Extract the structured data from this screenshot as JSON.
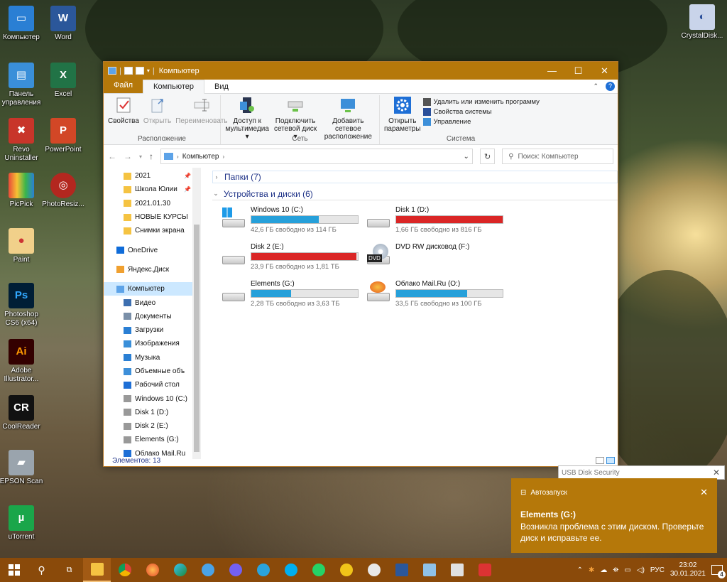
{
  "desktop": {
    "icons": [
      {
        "label": "Компьютер"
      },
      {
        "label": "Word"
      },
      {
        "label": "Панель управления"
      },
      {
        "label": "Excel"
      },
      {
        "label": "Revo Uninstaller"
      },
      {
        "label": "PowerPoint"
      },
      {
        "label": "PicPick"
      },
      {
        "label": "PhotoResiz..."
      },
      {
        "label": "Paint"
      },
      {
        "label": "Photoshop CS6 (x64)"
      },
      {
        "label": "Adobe Illustrator..."
      },
      {
        "label": "CoolReader"
      },
      {
        "label": "EPSON Scan"
      },
      {
        "label": "uTorrent"
      },
      {
        "label": "CrystalDisk..."
      }
    ],
    "glyphs": {
      "word": "W",
      "excel": "X",
      "powerpoint": "P",
      "photoshop": "Ps",
      "illustrator": "Ai",
      "coolreader": "CR",
      "utorrent": "µ"
    }
  },
  "window": {
    "title": "Компьютер",
    "controls": {
      "minimize": "—",
      "maximize": "☐",
      "close": "✕"
    },
    "tabs": {
      "file": "Файл",
      "computer": "Компьютер",
      "view": "Вид"
    },
    "ribbon": {
      "location": {
        "name": "Расположение",
        "properties": "Свойства",
        "open": "Открыть",
        "rename": "Переименовать"
      },
      "network": {
        "name": "Сеть",
        "media_1": "Доступ к",
        "media_2": "мультимедиа",
        "map_1": "Подключить",
        "map_2": "сетевой диск",
        "add_1": "Добавить сетевое",
        "add_2": "расположение"
      },
      "system": {
        "name": "Система",
        "open_1": "Открыть",
        "open_2": "параметры",
        "uninstall": "Удалить или изменить программу",
        "sysprops": "Свойства системы",
        "manage": "Управление"
      }
    },
    "address": {
      "path": "Компьютер",
      "search_placeholder": "Поиск: Компьютер"
    },
    "nav": [
      {
        "label": "2021",
        "pinned": true,
        "kind": "folder"
      },
      {
        "label": "Школа Юлии",
        "pinned": true,
        "kind": "folder"
      },
      {
        "label": "2021.01.30",
        "kind": "folder"
      },
      {
        "label": "НОВЫЕ КУРСЫ",
        "kind": "folder"
      },
      {
        "label": "Снимки экрана",
        "kind": "folder"
      },
      {
        "label": "",
        "kind": "spacer"
      },
      {
        "label": "OneDrive",
        "kind": "onedrive"
      },
      {
        "label": "",
        "kind": "spacer"
      },
      {
        "label": "Яндекс.Диск",
        "kind": "yadisk"
      },
      {
        "label": "",
        "kind": "spacer"
      },
      {
        "label": "Компьютер",
        "kind": "pc",
        "selected": true
      },
      {
        "label": "Видео",
        "kind": "video"
      },
      {
        "label": "Документы",
        "kind": "docs"
      },
      {
        "label": "Загрузки",
        "kind": "downloads"
      },
      {
        "label": "Изображения",
        "kind": "images"
      },
      {
        "label": "Музыка",
        "kind": "music"
      },
      {
        "label": "Объемные объ",
        "kind": "3d"
      },
      {
        "label": "Рабочий стол",
        "kind": "desktop"
      },
      {
        "label": "Windows 10 (C:)",
        "kind": "drive"
      },
      {
        "label": "Disk 1 (D:)",
        "kind": "drive"
      },
      {
        "label": "Disk 2 (E:)",
        "kind": "drive"
      },
      {
        "label": "Elements (G:)",
        "kind": "drive"
      },
      {
        "label": "Облако Mail.Ru",
        "kind": "cloud"
      }
    ],
    "groups": {
      "folders": "Папки (7)",
      "devices": "Устройства и диски (6)"
    },
    "drives": [
      {
        "name": "Windows 10 (C:)",
        "free": "42,6 ГБ свободно из 114 ГБ",
        "used": 0.63,
        "color": "#26a0da",
        "icon": "win"
      },
      {
        "name": "Disk 1 (D:)",
        "free": "1,66 ГБ свободно из 816 ГБ",
        "used": 0.998,
        "color": "#da2626",
        "icon": "hdd"
      },
      {
        "name": "Disk 2 (E:)",
        "free": "23,9 ГБ свободно из 1,81 ТБ",
        "used": 0.987,
        "color": "#da2626",
        "icon": "hdd"
      },
      {
        "name": "DVD RW дисковод (F:)",
        "free": "",
        "used": null,
        "color": "",
        "icon": "dvd"
      },
      {
        "name": "Elements (G:)",
        "free": "2,28 ТБ свободно из 3,63 ТБ",
        "used": 0.37,
        "color": "#26a0da",
        "icon": "hdd"
      },
      {
        "name": "Облако Mail.Ru (O:)",
        "free": "33,5 ГБ свободно из 100 ГБ",
        "used": 0.665,
        "color": "#26a0da",
        "icon": "cloud"
      }
    ],
    "dvd_label": "DVD",
    "status": "Элементов: 13"
  },
  "usb_security": {
    "title": "USB Disk Security"
  },
  "toast": {
    "app": "Автозапуск",
    "title": "Elements (G:)",
    "body": "Возникла проблема с этим диском. Проверьте диск и исправьте ее."
  },
  "taskbar": {
    "lang": "РУС",
    "time": "23:02",
    "date": "30.01.2021",
    "notifications": "4"
  }
}
